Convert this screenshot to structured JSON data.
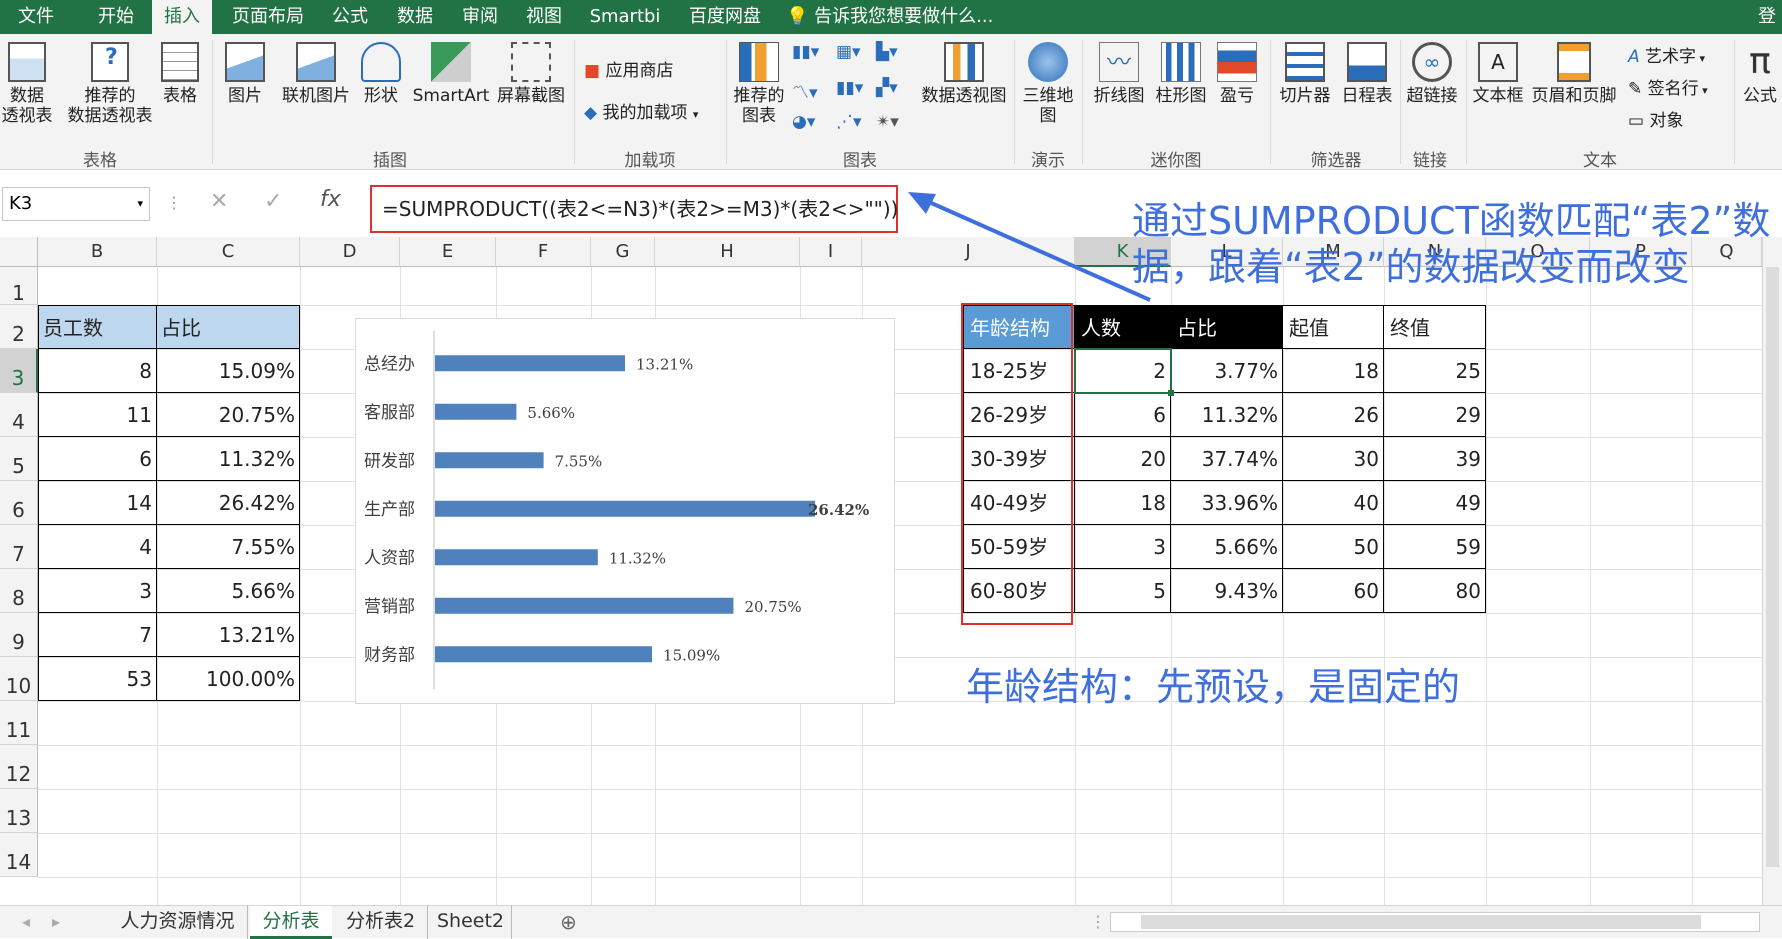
{
  "ribbon_tabs": [
    "文件",
    "开始",
    "插入",
    "页面布局",
    "公式",
    "数据",
    "审阅",
    "视图",
    "Smartbi",
    "百度网盘"
  ],
  "active_tab": "插入",
  "tell_me": "告诉我您想要做什么...",
  "login": "登",
  "ribbon": {
    "pivot": "数据\n透视表",
    "rec_pivot": "推荐的\n数据透视表",
    "table": "表格",
    "group_tables": "表格",
    "picture": "图片",
    "online_picture": "联机图片",
    "shapes": "形状",
    "smartart": "SmartArt",
    "screenshot": "屏幕截图",
    "group_illustrations": "插图",
    "app_store": "应用商店",
    "my_addins": "我的加载项",
    "group_addins": "加载项",
    "rec_charts": "推荐的\n图表",
    "pivot_chart": "数据透视图",
    "group_charts": "图表",
    "map3d": "三维地\n图",
    "group_tours": "演示",
    "line": "折线图",
    "column": "柱形图",
    "winloss": "盈亏",
    "group_sparklines": "迷你图",
    "slicer": "切片器",
    "timeline": "日程表",
    "group_filters": "筛选器",
    "hyperlink": "超链接",
    "group_links": "链接",
    "textbox": "文本框",
    "header_footer": "页眉和页脚",
    "wordart": "艺术字",
    "signature": "签名行",
    "object": "对象",
    "group_text": "文本",
    "equation": "公式"
  },
  "name_box": "K3",
  "formula": "=SUMPRODUCT((表2<=N3)*(表2>=M3)*(表2<>\"\"))",
  "columns": [
    "B",
    "C",
    "D",
    "E",
    "F",
    "G",
    "H",
    "I",
    "J",
    "K",
    "L",
    "M",
    "N",
    "O",
    "P",
    "Q"
  ],
  "rows": [
    "1",
    "2",
    "3",
    "4",
    "5",
    "6",
    "7",
    "8",
    "9",
    "10",
    "11",
    "12",
    "13",
    "14"
  ],
  "left_table": {
    "headers": [
      "员工数",
      "占比"
    ],
    "rows": [
      [
        "8",
        "15.09%"
      ],
      [
        "11",
        "20.75%"
      ],
      [
        "6",
        "11.32%"
      ],
      [
        "14",
        "26.42%"
      ],
      [
        "4",
        "7.55%"
      ],
      [
        "3",
        "5.66%"
      ],
      [
        "7",
        "13.21%"
      ],
      [
        "53",
        "100.00%"
      ]
    ]
  },
  "chart_data": {
    "type": "bar",
    "orientation": "horizontal",
    "categories": [
      "总经办",
      "客服部",
      "研发部",
      "生产部",
      "人资部",
      "营销部",
      "财务部"
    ],
    "values": [
      13.21,
      5.66,
      7.55,
      26.42,
      11.32,
      20.75,
      15.09
    ],
    "labels": [
      "13.21%",
      "5.66%",
      "7.55%",
      "26.42%",
      "11.32%",
      "20.75%",
      "15.09%"
    ],
    "bold_label_index": 3,
    "color": "#4f81bd",
    "xlim": [
      0,
      26.42
    ]
  },
  "right_table": {
    "headers": [
      "年龄结构",
      "人数",
      "占比",
      "起值",
      "终值"
    ],
    "rows": [
      [
        "18-25岁",
        "2",
        "3.77%",
        "18",
        "25"
      ],
      [
        "26-29岁",
        "6",
        "11.32%",
        "26",
        "29"
      ],
      [
        "30-39岁",
        "20",
        "37.74%",
        "30",
        "39"
      ],
      [
        "40-49岁",
        "18",
        "33.96%",
        "40",
        "49"
      ],
      [
        "50-59岁",
        "3",
        "5.66%",
        "50",
        "59"
      ],
      [
        "60-80岁",
        "5",
        "9.43%",
        "60",
        "80"
      ]
    ]
  },
  "annotations": {
    "note1_line1": "通过SUMPRODUCT函数匹配“表2”数",
    "note1_line2": "据，跟着“表2”的数据改变而改变",
    "note2": "年龄结构：先预设，是固定的"
  },
  "sheet_tabs": [
    "人力资源情况",
    "分析表",
    "分析表2",
    "Sheet2"
  ],
  "active_sheet": "分析表",
  "colors": {
    "excel_green": "#217346",
    "highlight_red": "#e03030",
    "note_blue": "#3f6fdc",
    "header_blue": "#bdd7ee",
    "dark_header": "#000000",
    "sel_header": "#5b9bd5"
  }
}
